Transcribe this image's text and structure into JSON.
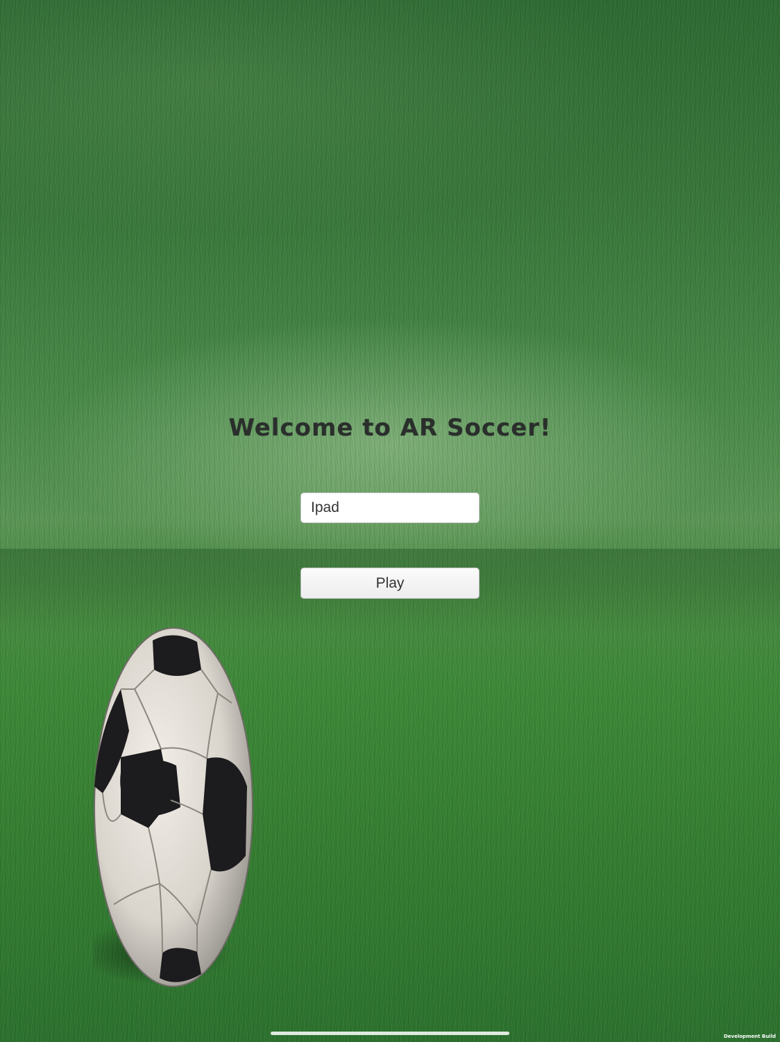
{
  "welcome": {
    "title": "Welcome to AR Soccer!"
  },
  "login": {
    "name_value": "Ipad",
    "play_label": "Play"
  },
  "footer": {
    "build_label": "Development Build"
  },
  "decor": {
    "ball_icon": "soccer-ball-icon",
    "grass_color": "#3f7a3c",
    "title_color": "#2a2f2c"
  }
}
